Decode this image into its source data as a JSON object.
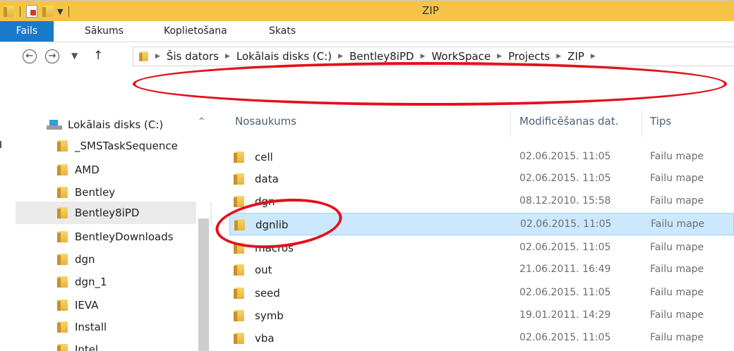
{
  "window": {
    "title": "ZIP",
    "accent": "#f5c445"
  },
  "ribbon": {
    "tabs": [
      "Fails",
      "Sākums",
      "Koplietošana",
      "Skats"
    ]
  },
  "nav": {
    "back_icon": "back-icon",
    "forward_icon": "forward-icon",
    "recent_icon": "chevron-down-icon",
    "up_icon": "up-arrow-icon"
  },
  "breadcrumb": [
    "Šis dators",
    "Lokālais disks (C:)",
    "Bentley8iPD",
    "WorkSpace",
    "Projects",
    "ZIP"
  ],
  "tree": {
    "root": "Lokālais disks (C:)",
    "items": [
      "_SMSTaskSequence",
      "AMD",
      "Bentley",
      "Bentley8iPD",
      "BentleyDownloads",
      "dgn",
      "dgn_1",
      "IEVA",
      "Install",
      "Intel"
    ],
    "selected": "Bentley8iPD"
  },
  "columns": {
    "name": "Nosaukums",
    "date": "Modificēšanas dat.",
    "type": "Tips"
  },
  "files": [
    {
      "name": "cell",
      "date": "02.06.2015. 11:05",
      "type": "Failu mape"
    },
    {
      "name": "data",
      "date": "02.06.2015. 11:05",
      "type": "Failu mape"
    },
    {
      "name": "dgn",
      "date": "08.12.2010. 15:58",
      "type": "Failu mape"
    },
    {
      "name": "dgnlib",
      "date": "02.06.2015. 11:05",
      "type": "Failu mape"
    },
    {
      "name": "macros",
      "date": "02.06.2015. 11:05",
      "type": "Failu mape"
    },
    {
      "name": "out",
      "date": "21.06.2011. 16:49",
      "type": "Failu mape"
    },
    {
      "name": "seed",
      "date": "02.06.2015. 11:05",
      "type": "Failu mape"
    },
    {
      "name": "symb",
      "date": "19.01.2011. 14:29",
      "type": "Failu mape"
    },
    {
      "name": "vba",
      "date": "02.06.2015. 11:05",
      "type": "Failu mape"
    }
  ],
  "selected_file": "dgnlib",
  "highlight_color": "#e3101b"
}
